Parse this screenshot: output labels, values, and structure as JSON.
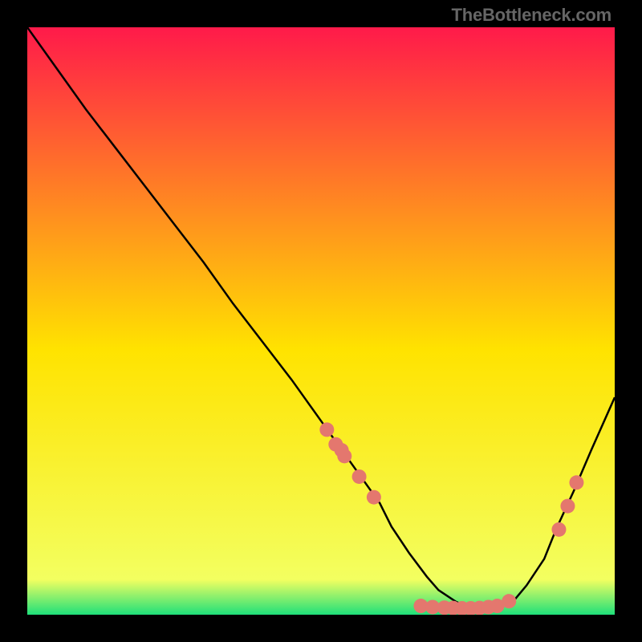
{
  "attribution": "TheBottleneck.com",
  "chart_data": {
    "type": "line",
    "title": "",
    "xlabel": "",
    "ylabel": "",
    "xlim": [
      0,
      100
    ],
    "ylim": [
      0,
      100
    ],
    "grid": false,
    "legend": false,
    "background_gradient_top": "#ff1a4a",
    "background_gradient_mid": "#ffe300",
    "background_gradient_bottom": "#1fe07a",
    "curve_x": [
      0,
      5,
      10,
      15,
      20,
      25,
      30,
      35,
      40,
      45,
      50,
      55,
      60,
      62,
      65,
      68,
      70,
      73,
      75,
      78,
      80,
      83,
      85,
      88,
      90,
      93,
      96,
      100
    ],
    "curve_y": [
      100,
      93,
      86,
      79.5,
      73,
      66.5,
      60,
      53,
      46.5,
      40,
      33,
      26,
      19,
      15,
      10.5,
      6.5,
      4.2,
      2.2,
      1.3,
      1.1,
      1.3,
      2.6,
      5.0,
      9.5,
      14.5,
      21,
      28,
      37
    ],
    "markers": [
      {
        "x": 51,
        "y": 31.5
      },
      {
        "x": 52.5,
        "y": 29
      },
      {
        "x": 54,
        "y": 27
      },
      {
        "x": 53.5,
        "y": 28
      },
      {
        "x": 56.5,
        "y": 23.5
      },
      {
        "x": 59,
        "y": 20
      },
      {
        "x": 67,
        "y": 1.5
      },
      {
        "x": 69,
        "y": 1.3
      },
      {
        "x": 71,
        "y": 1.2
      },
      {
        "x": 72.5,
        "y": 1.15
      },
      {
        "x": 74,
        "y": 1.1
      },
      {
        "x": 75.5,
        "y": 1.1
      },
      {
        "x": 77,
        "y": 1.15
      },
      {
        "x": 78.5,
        "y": 1.3
      },
      {
        "x": 80,
        "y": 1.5
      },
      {
        "x": 82,
        "y": 2.3
      },
      {
        "x": 90.5,
        "y": 14.5
      },
      {
        "x": 92,
        "y": 18.5
      },
      {
        "x": 93.5,
        "y": 22.5
      }
    ],
    "marker_color": "#e4776e",
    "marker_radius": 9,
    "line_color": "#000000",
    "line_width": 2.5
  }
}
